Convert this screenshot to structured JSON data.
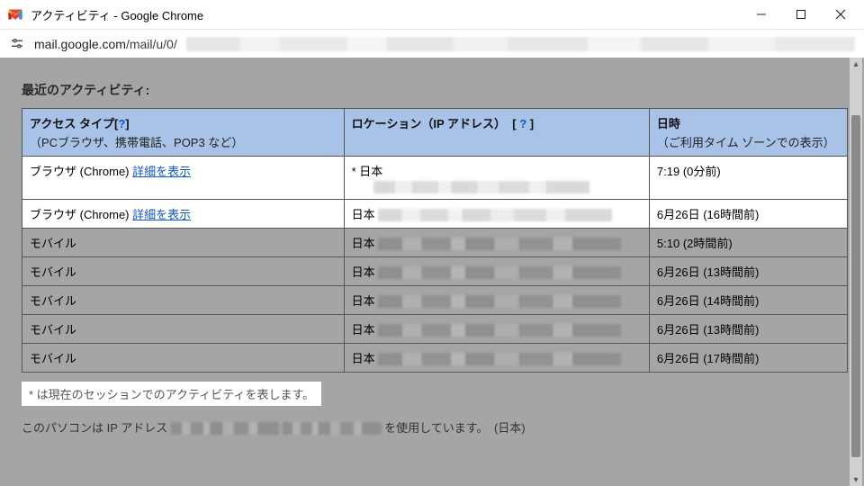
{
  "window": {
    "title": "アクティビティ - Google Chrome"
  },
  "addressbar": {
    "host": "mail.google.com",
    "path": "/mail/u/0/"
  },
  "heading": "最近のアクティビティ:",
  "table": {
    "headers": {
      "access_type": "アクセス タイプ",
      "access_type_help": "?",
      "access_type_sub": "（PCブラウザ、携帯電話、POP3 など）",
      "location": "ロケーション（IP アドレス）",
      "location_help": "?",
      "datetime": "日時",
      "datetime_sub": "（ご利用タイム ゾーンでの表示）"
    },
    "rows": [
      {
        "variant": "white",
        "access": "ブラウザ (Chrome) ",
        "detail_link": "詳細を表示",
        "loc_prefix": "* 日本",
        "loc_blur_w": 240,
        "loc_two_lines": true,
        "time": "7:19 (0分前)"
      },
      {
        "variant": "white",
        "access": "ブラウザ (Chrome) ",
        "detail_link": "詳細を表示",
        "loc_prefix": "日本",
        "loc_blur_w": 260,
        "time": "6月26日 (16時間前)"
      },
      {
        "variant": "gray",
        "access": "モバイル",
        "loc_prefix": "日本",
        "loc_blur_w": 270,
        "time": "5:10 (2時間前)"
      },
      {
        "variant": "gray",
        "access": "モバイル",
        "loc_prefix": "日本",
        "loc_blur_w": 270,
        "time": "6月26日 (13時間前)"
      },
      {
        "variant": "gray",
        "access": "モバイル",
        "loc_prefix": "日本",
        "loc_blur_w": 270,
        "time": "6月26日 (14時間前)"
      },
      {
        "variant": "gray",
        "access": "モバイル",
        "loc_prefix": "日本",
        "loc_blur_w": 270,
        "time": "6月26日 (13時間前)"
      },
      {
        "variant": "gray",
        "access": "モバイル",
        "loc_prefix": "日本",
        "loc_blur_w": 270,
        "time": "6月26日 (17時間前)"
      }
    ]
  },
  "footnote": "* は現在のセッションでのアクティビティを表します。",
  "ipline": {
    "prefix": "このパソコンは IP アドレス",
    "suffix": "を使用しています。　(日本)"
  }
}
